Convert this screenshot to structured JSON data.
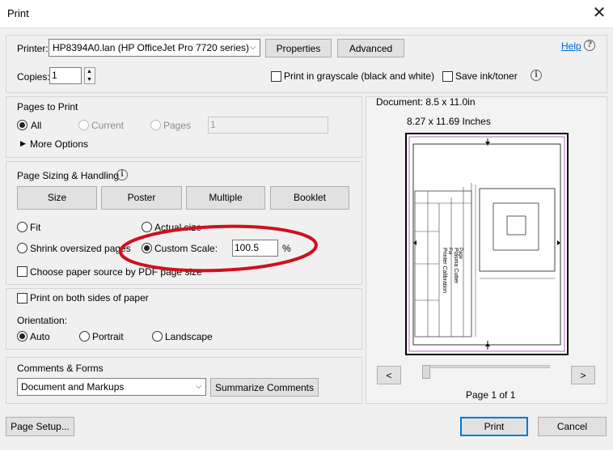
{
  "window": {
    "title": "Print",
    "close_glyph": "✕"
  },
  "printer": {
    "label": "Printer:",
    "value": "HP8394A0.lan (HP OfficeJet Pro 7720 series)",
    "properties_label": "Properties",
    "advanced_label": "Advanced",
    "help_label": "Help"
  },
  "copies": {
    "label": "Copies:",
    "value": "1",
    "grayscale_label": "Print in grayscale (black and white)",
    "save_ink_label": "Save ink/toner"
  },
  "pages_to_print": {
    "heading": "Pages to Print",
    "all_label": "All",
    "current_label": "Current",
    "pages_label": "Pages",
    "pages_value": "1",
    "more_options_label": "More Options"
  },
  "sizing": {
    "heading": "Page Sizing & Handling",
    "tabs": [
      "Size",
      "Poster",
      "Multiple",
      "Booklet"
    ],
    "fit_label": "Fit",
    "actual_size_label": "Actual size",
    "shrink_label": "Shrink oversized pages",
    "custom_scale_label": "Custom Scale:",
    "custom_scale_value": "100.5",
    "percent_label": "%",
    "paper_source_label": "Choose paper source by PDF page size"
  },
  "duplex": {
    "label": "Print on both sides of paper"
  },
  "orientation": {
    "heading": "Orientation:",
    "auto_label": "Auto",
    "portrait_label": "Portrait",
    "landscape_label": "Landscape"
  },
  "comments": {
    "heading": "Comments & Forms",
    "value": "Document and Markups",
    "summarize_label": "Summarize Comments"
  },
  "preview": {
    "document_size": "Document: 8.5 x 11.0in",
    "paper_size": "8.27 x 11.69 Inches",
    "page_text_1": "Plasma Cutter",
    "page_text_2": "Printer Calibration",
    "page_text_3": "Page",
    "page_text_4": "For",
    "prev_glyph": "<",
    "next_glyph": ">",
    "page_indicator": "Page 1 of 1"
  },
  "footer": {
    "page_setup_label": "Page Setup...",
    "print_label": "Print",
    "cancel_label": "Cancel"
  },
  "colors": {
    "annotation_ellipse": "#d0101e",
    "link": "#0066cc"
  }
}
